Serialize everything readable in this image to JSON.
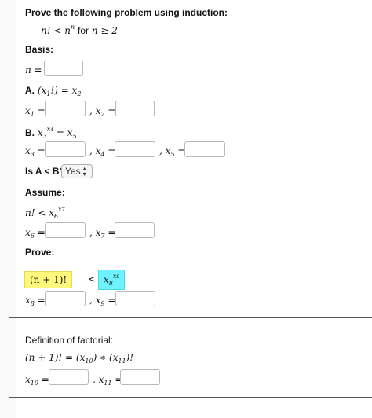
{
  "title": "Prove the following problem using induction:",
  "statement": {
    "lhs": "n!",
    "op": "<",
    "rhs": "n",
    "rhs_sup": "n",
    "for_word": "for",
    "cond": "n ≥ 2"
  },
  "basis": {
    "heading": "Basis:",
    "n_label": "n =",
    "a_label": "A.",
    "a_expr": "(x",
    "a_sub": "1",
    "a_tail": "!) = x",
    "a_sub2": "2",
    "x1_label": "x",
    "x1_sub": "1",
    "x2_label": ", x",
    "x2_sub": "2",
    "b_label": "B.",
    "b_x": "x",
    "b_sub": "3",
    "b_sup_x": "x",
    "b_sup_sub": "4",
    "b_tail": " = x",
    "b_tail_sub": "5",
    "x3_sub": "3",
    "x4_sub": "4",
    "x5_sub": "5",
    "eq": " =",
    "is_ab_label": "Is A < B?",
    "is_ab_value": "Yes"
  },
  "assume": {
    "heading": "Assume:",
    "expr_lhs": "n! < x",
    "expr_sub": "6",
    "expr_sup": "x",
    "expr_sup_sub": "7",
    "x6_sub": "6",
    "x7_sub": "7"
  },
  "prove": {
    "heading": "Prove:",
    "lhs": "(n + 1)!",
    "op": "<",
    "rhs_x": "x",
    "rhs_sub": "8",
    "rhs_sup": "x",
    "rhs_sup_sub": "9",
    "x8_sub": "8",
    "x9_sub": "9"
  },
  "factorial": {
    "heading": "Definition of factorial:",
    "expr": "(n + 1)! = (x",
    "sub10": "10",
    "mid": ") ∗ (x",
    "sub11": "11",
    "tail": ")!",
    "x10_sub": "10",
    "x11_sub": "11"
  },
  "colors": {
    "highlight_yellow": "#fff87a",
    "highlight_cyan": "#6ff2ff"
  }
}
